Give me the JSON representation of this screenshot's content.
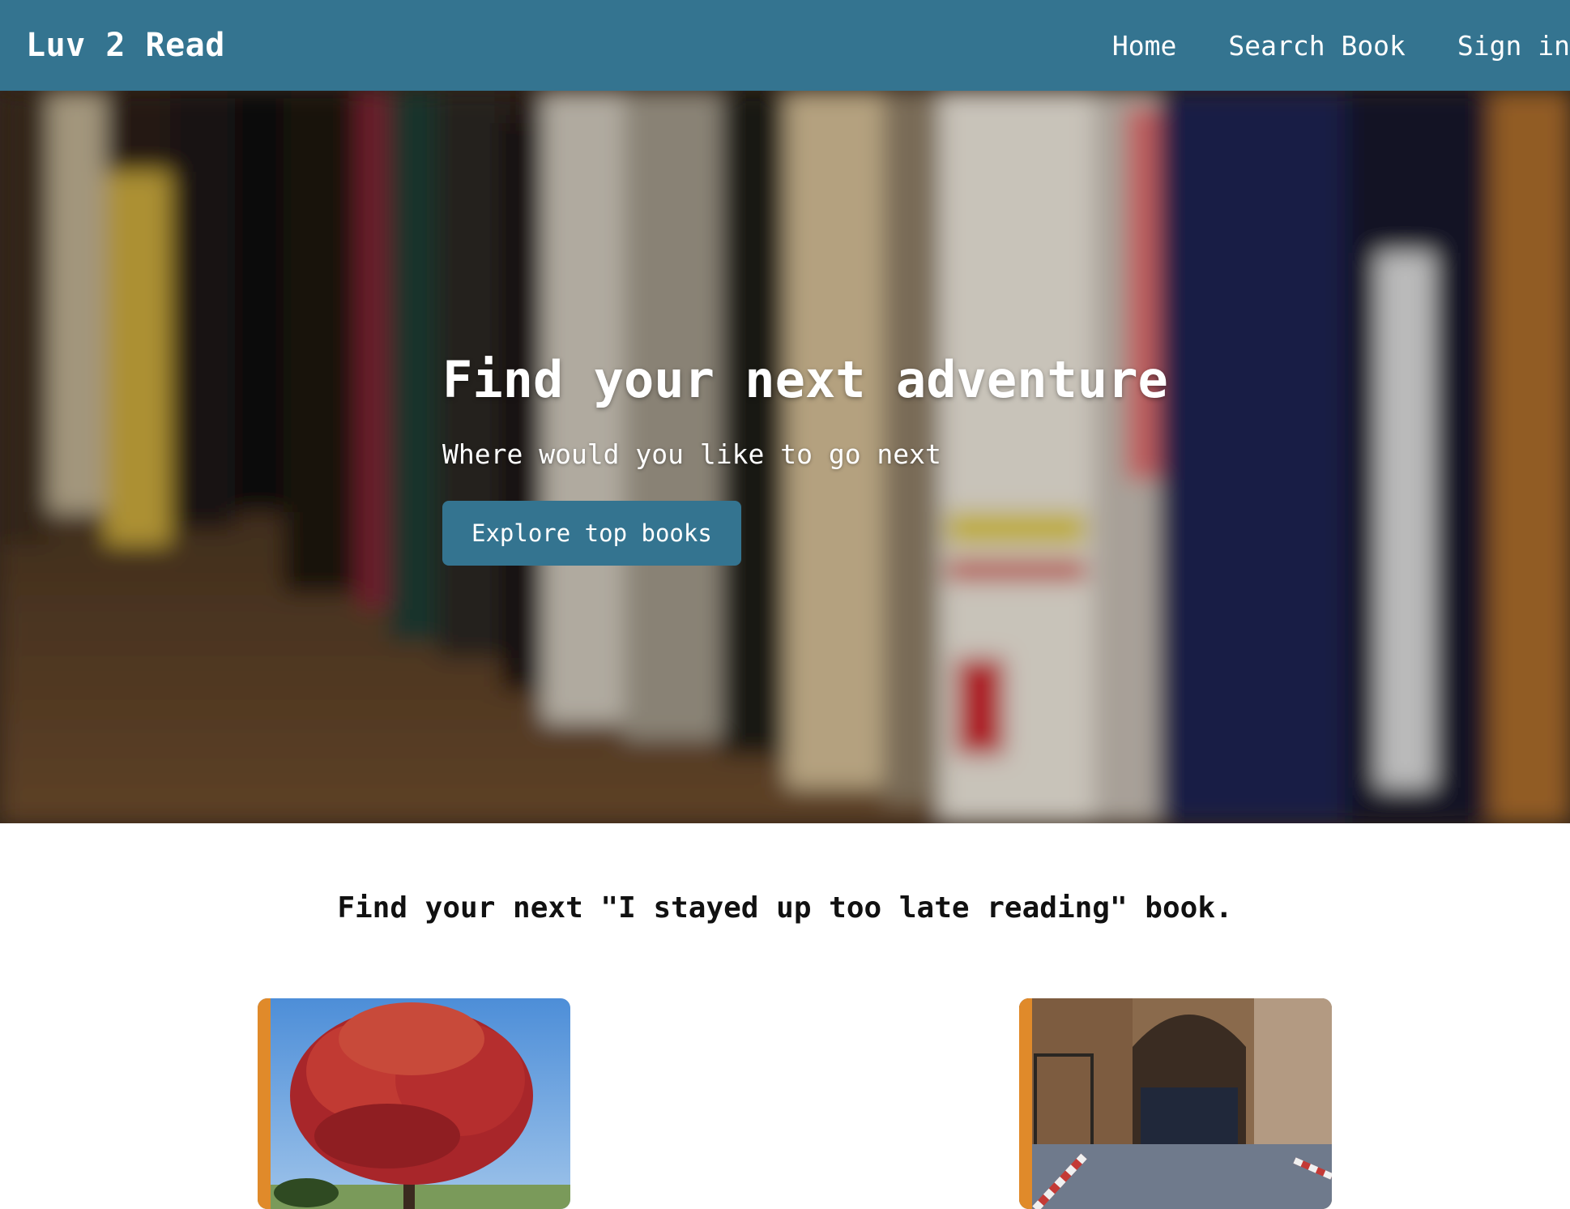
{
  "navbar": {
    "brand": "Luv 2 Read",
    "links": [
      {
        "label": "Home"
      },
      {
        "label": "Search Book"
      },
      {
        "label": "Sign in"
      }
    ]
  },
  "hero": {
    "title": "Find your next adventure",
    "subtitle": "Where would you like to go next",
    "button_label": "Explore top books"
  },
  "tagline": "Find your next \"I stayed up too late reading\" book.",
  "books": [
    {
      "image": "red-tree-cover"
    },
    {
      "image": "stone-archway-cover"
    }
  ],
  "colors": {
    "primary": "#347490",
    "book_spine": "#e08a2a"
  }
}
